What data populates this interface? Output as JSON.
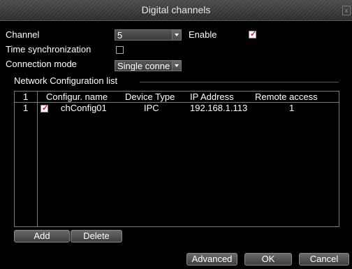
{
  "window": {
    "title": "Digital channels",
    "close_glyph": "x"
  },
  "form": {
    "channel_label": "Channel",
    "channel_value": "5",
    "enable_label": "Enable",
    "enable_checked": true,
    "time_sync_label": "Time synchronization",
    "time_sync_checked": false,
    "connection_mode_label": "Connection mode",
    "connection_mode_value": "Single conne"
  },
  "list": {
    "section_label": "Network Configuration list",
    "headers": {
      "index": "1",
      "name": "Configur. name",
      "device_type": "Device Type",
      "ip": "IP Address",
      "remote": "Remote access"
    },
    "rows": [
      {
        "index": "1",
        "checked": true,
        "name": "chConfig01",
        "device_type": "IPC",
        "ip": "192.168.1.113",
        "remote": "1"
      }
    ]
  },
  "buttons": {
    "add": "Add",
    "delete": "Delete",
    "advanced": "Advanced",
    "ok": "OK",
    "cancel": "Cancel"
  },
  "colors": {
    "checkmark": "#d0143c",
    "background": "#000000"
  }
}
